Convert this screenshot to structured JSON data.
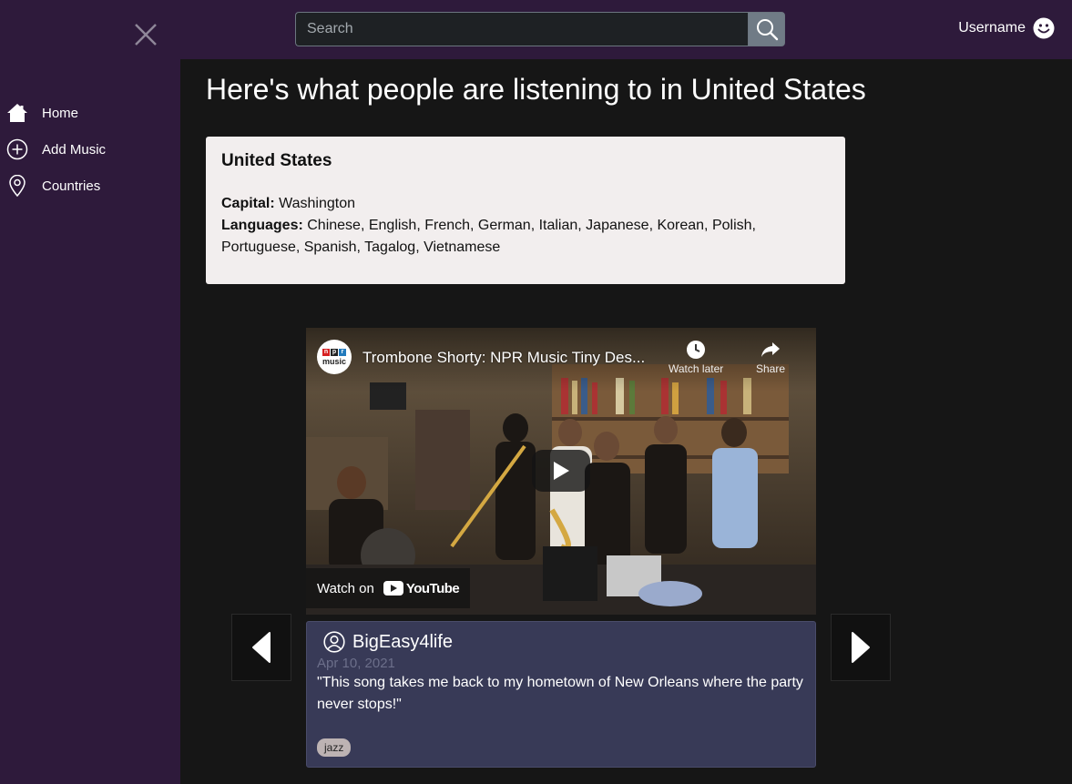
{
  "header": {
    "search_placeholder": "Search",
    "username": "Username"
  },
  "sidebar": {
    "items": [
      {
        "label": "Home",
        "icon": "home-icon"
      },
      {
        "label": "Add Music",
        "icon": "plus-circle-icon"
      },
      {
        "label": "Countries",
        "icon": "map-pin-icon"
      }
    ]
  },
  "main": {
    "heading": "Here's what people are listening to in United States"
  },
  "country": {
    "name": "United States",
    "capital_label": "Capital:",
    "capital": "Washington",
    "languages_label": "Languages:",
    "languages": "Chinese, English, French, German, Italian, Japanese, Korean, Polish, Portuguese, Spanish, Tagalog, Vietnamese"
  },
  "video": {
    "channel_logo_text": "music",
    "title": "Trombone Shorty: NPR Music Tiny Des...",
    "watch_later": "Watch later",
    "share": "Share",
    "watch_on": "Watch on",
    "youtube": "YouTube"
  },
  "post": {
    "username": "BigEasy4life",
    "date": "Apr 10, 2021",
    "quote": "\"This song takes me back to my hometown of New Orleans where the party never stops!\"",
    "tag": "jazz"
  },
  "colors": {
    "topbar": "#2e1a3b",
    "page_bg": "#161616",
    "info_card": "#f2eeee",
    "post_card": "#383a57",
    "tag": "#bdb3b3"
  }
}
